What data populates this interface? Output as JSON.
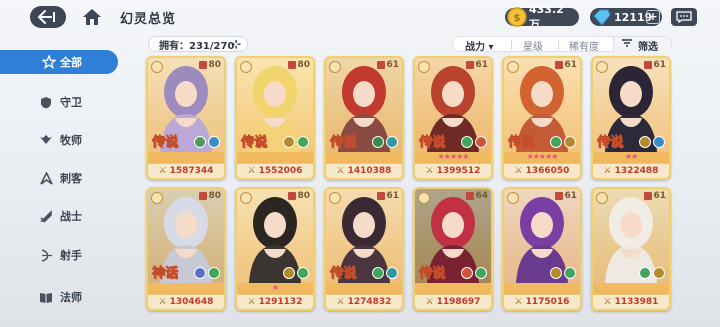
{
  "header": {
    "title": "幻灵总览",
    "back_icon": "back-arrow-icon",
    "home_icon": "home-icon",
    "gold": "433.2万",
    "gems": "12119",
    "plus": "+"
  },
  "sidebar": {
    "items": [
      {
        "label": "全部",
        "icon": "all-star-icon",
        "active": true
      },
      {
        "label": "守卫",
        "icon": "guard-shield-icon",
        "active": false
      },
      {
        "label": "牧师",
        "icon": "priest-wings-icon",
        "active": false
      },
      {
        "label": "刺客",
        "icon": "assassin-icon",
        "active": false
      },
      {
        "label": "战士",
        "icon": "warrior-sword-icon",
        "active": false
      },
      {
        "label": "射手",
        "icon": "archer-bow-icon",
        "active": false
      },
      {
        "label": "法师",
        "icon": "mage-book-icon",
        "active": false
      }
    ]
  },
  "filters": {
    "owned": "拥有：231/270",
    "owned_toggle": "⊹",
    "sort_options": [
      "战力 ▾",
      "星级",
      "稀有度"
    ],
    "filter_label": "筛选"
  },
  "cards": [
    {
      "level": "80",
      "legend": "传说",
      "stars": "",
      "power": "1587344",
      "colors": [
        "#b9a8d8",
        "#e8d3c8"
      ],
      "hair": "#9c8bbf",
      "orbs": [
        "#4f9a5a",
        "#3a8cc8"
      ]
    },
    {
      "level": "80",
      "legend": "传说",
      "stars": "",
      "power": "1552006",
      "colors": [
        "#f4d27a",
        "#f7e3b0"
      ],
      "hair": "#f1d46c",
      "orbs": [
        "#b58a2a",
        "#3fa65a"
      ]
    },
    {
      "level": "61",
      "legend": "传说",
      "stars": "",
      "power": "1410388",
      "colors": [
        "#8a4b42",
        "#d9b89c"
      ],
      "hair": "#c2392f",
      "orbs": [
        "#3b8c4c",
        "#2f97a6"
      ]
    },
    {
      "level": "61",
      "legend": "传说",
      "stars": "★★★★★",
      "power": "1399512",
      "colors": [
        "#6f2a28",
        "#e7b79c"
      ],
      "hair": "#b9432d",
      "orbs": [
        "#3fa65a",
        "#d0543a"
      ]
    },
    {
      "level": "61",
      "legend": "传说",
      "stars": "★★★★★",
      "power": "1366050",
      "colors": [
        "#c55a36",
        "#f5d3b8"
      ],
      "hair": "#d2622f",
      "orbs": [
        "#3fa65a",
        "#b58a2a"
      ]
    },
    {
      "level": "61",
      "legend": "传说",
      "stars": "★★",
      "power": "1322488",
      "colors": [
        "#2c2a3a",
        "#f1d8d0"
      ],
      "hair": "#2b2535",
      "orbs": [
        "#b58a2a",
        "#3a8cc8"
      ]
    },
    {
      "level": "80",
      "legend": "神话",
      "stars": "",
      "power": "1304648",
      "colors": [
        "#c9c9d6",
        "#9aa2b8"
      ],
      "hair": "#d8dbe6",
      "orbs": [
        "#5b6fc7",
        "#3fa65a"
      ]
    },
    {
      "level": "80",
      "legend": "",
      "stars": "★",
      "power": "1291132",
      "colors": [
        "#3a3530",
        "#eed7bd"
      ],
      "hair": "#2c2622",
      "orbs": [
        "#b58a2a",
        "#3fa65a"
      ]
    },
    {
      "level": "61",
      "legend": "传说",
      "stars": "",
      "power": "1274832",
      "colors": [
        "#4a3640",
        "#e9c7b3"
      ],
      "hair": "#3a2a33",
      "orbs": [
        "#3fa65a",
        "#2f97a6"
      ]
    },
    {
      "level": "64",
      "legend": "传说",
      "stars": "",
      "power": "1198697",
      "colors": [
        "#7a2232",
        "#1b2a4a"
      ],
      "hair": "#c23044",
      "orbs": [
        "#d0543a",
        "#3fa65a"
      ]
    },
    {
      "level": "61",
      "legend": "",
      "stars": "",
      "power": "1175016",
      "colors": [
        "#6a3a8c",
        "#d6b6e6"
      ],
      "hair": "#7b3fa3",
      "orbs": [
        "#b58a2a",
        "#3fa65a"
      ]
    },
    {
      "level": "61",
      "legend": "",
      "stars": "",
      "power": "1133981",
      "colors": [
        "#efe9e1",
        "#d1c6bc"
      ],
      "hair": "#f1ede6",
      "orbs": [
        "#3fa65a",
        "#b58a2a"
      ]
    }
  ]
}
